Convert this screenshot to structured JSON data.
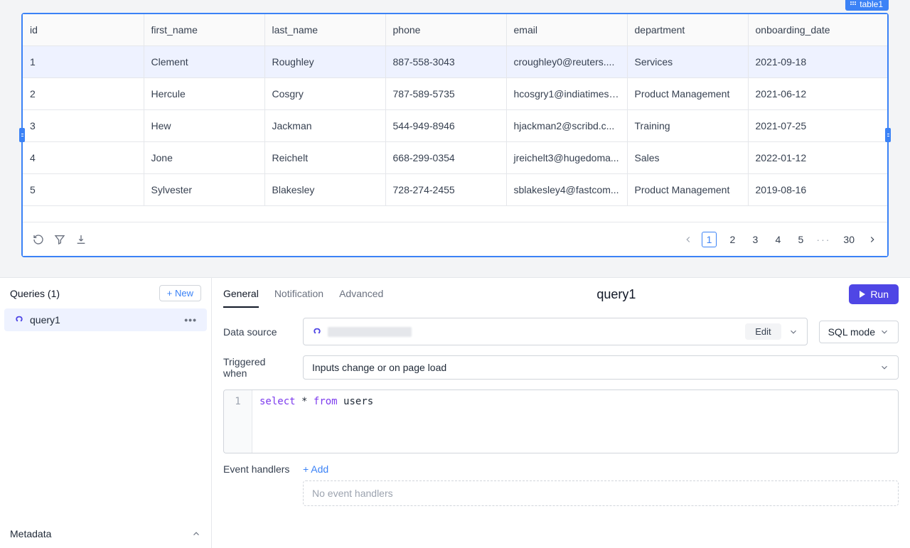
{
  "table_widget": {
    "tag": "table1",
    "columns": [
      "id",
      "first_name",
      "last_name",
      "phone",
      "email",
      "department",
      "onboarding_date"
    ],
    "rows": [
      {
        "id": "1",
        "first_name": "Clement",
        "last_name": "Roughley",
        "phone": "887-558-3043",
        "email": "croughley0@reuters....",
        "department": "Services",
        "onboarding_date": "2021-09-18"
      },
      {
        "id": "2",
        "first_name": "Hercule",
        "last_name": "Cosgry",
        "phone": "787-589-5735",
        "email": "hcosgry1@indiatimes....",
        "department": "Product Management",
        "onboarding_date": "2021-06-12"
      },
      {
        "id": "3",
        "first_name": "Hew",
        "last_name": "Jackman",
        "phone": "544-949-8946",
        "email": "hjackman2@scribd.c...",
        "department": "Training",
        "onboarding_date": "2021-07-25"
      },
      {
        "id": "4",
        "first_name": "Jone",
        "last_name": "Reichelt",
        "phone": "668-299-0354",
        "email": "jreichelt3@hugedoma...",
        "department": "Sales",
        "onboarding_date": "2022-01-12"
      },
      {
        "id": "5",
        "first_name": "Sylvester",
        "last_name": "Blakesley",
        "phone": "728-274-2455",
        "email": "sblakesley4@fastcom...",
        "department": "Product Management",
        "onboarding_date": "2019-08-16"
      }
    ],
    "pagination": {
      "pages": [
        "1",
        "2",
        "3",
        "4",
        "5"
      ],
      "ellipsis": "···",
      "last": "30",
      "active": "1"
    }
  },
  "queries_panel": {
    "title": "Queries (1)",
    "new_label": "+ New",
    "items": [
      {
        "name": "query1"
      }
    ],
    "metadata_label": "Metadata"
  },
  "editor": {
    "tabs": {
      "general": "General",
      "notification": "Notification",
      "advanced": "Advanced"
    },
    "query_name": "query1",
    "run_label": "Run",
    "data_source": {
      "label": "Data source",
      "edit": "Edit",
      "sql_mode": "SQL mode"
    },
    "trigger": {
      "label": "Triggered when",
      "value": "Inputs change or on page load"
    },
    "sql": {
      "line": "1",
      "kw_select": "select",
      "star": "*",
      "kw_from": "from",
      "table": "users"
    },
    "event_handlers": {
      "label": "Event handlers",
      "add": "+ Add",
      "empty": "No event handlers"
    }
  }
}
